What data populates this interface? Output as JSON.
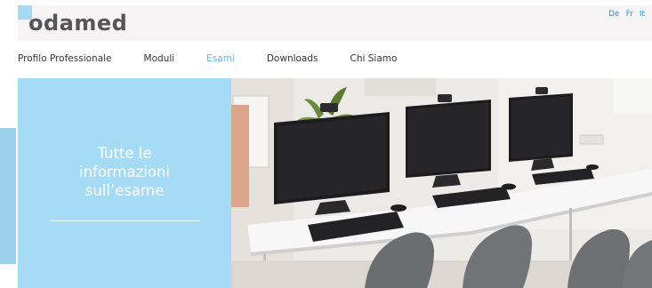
{
  "header": {
    "logo_text": "odamed",
    "languages": [
      "De",
      "Fr",
      "It"
    ]
  },
  "nav": {
    "items": [
      {
        "label": "Profilo Professionale",
        "active": false
      },
      {
        "label": "Moduli",
        "active": false
      },
      {
        "label": "Esami",
        "active": true
      },
      {
        "label": "Downloads",
        "active": false
      },
      {
        "label": "Chi Siamo",
        "active": false
      }
    ]
  },
  "hero": {
    "title_lines": [
      "Tutte le",
      "informazioni",
      "sull’esame"
    ]
  },
  "colors": {
    "accent_blue": "#a6dbf6",
    "active_link": "#5db8ea",
    "lang_link": "#2a9fd8"
  }
}
